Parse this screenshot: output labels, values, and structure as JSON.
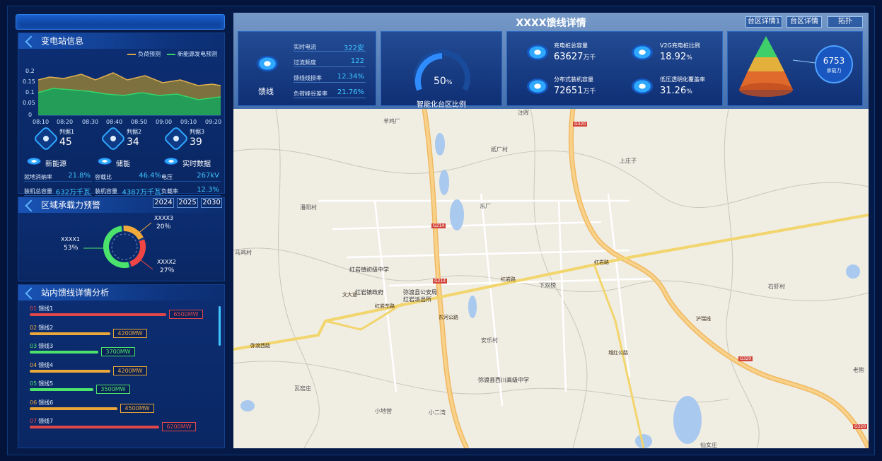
{
  "left": {
    "substation": {
      "title": "变电站信息",
      "legend": [
        {
          "label": "负荷预测",
          "color": "#d9a84a"
        },
        {
          "label": "新能源发电预测",
          "color": "#36d46a"
        }
      ],
      "y_ticks": [
        "0.2",
        "0.15",
        "0.1",
        "0.05",
        "0"
      ],
      "x_ticks": [
        "08:10",
        "08:20",
        "08:30",
        "08:40",
        "08:50",
        "09:00",
        "09:10",
        "09:20"
      ],
      "judges": [
        {
          "label": "判据1",
          "value": "45"
        },
        {
          "label": "判据2",
          "value": "34"
        },
        {
          "label": "判据3",
          "value": "39"
        }
      ],
      "sections": [
        {
          "title": "新能源",
          "rows": [
            {
              "k": "就地消纳率",
              "v": "21.8%"
            },
            {
              "k": "装机总容量",
              "v": "632万千瓦"
            }
          ]
        },
        {
          "title": "储能",
          "rows": [
            {
              "k": "容载比",
              "v": "46.4%"
            },
            {
              "k": "装机容量",
              "v": "4387万千瓦"
            }
          ]
        },
        {
          "title": "实时数据",
          "rows": [
            {
              "k": "电压",
              "v": "267kV"
            },
            {
              "k": "负载率",
              "v": "12.3%"
            }
          ]
        }
      ]
    },
    "warning": {
      "title": "区域承载力预警",
      "years": [
        "2024",
        "2025",
        "2030"
      ],
      "segments": [
        {
          "name": "XXXX1",
          "pct": "53％",
          "value": 53,
          "color": "#4be36c"
        },
        {
          "name": "XXXX2",
          "pct": "27％",
          "value": 27,
          "color": "#f04545"
        },
        {
          "name": "XXXX3",
          "pct": "20％",
          "value": 20,
          "color": "#f2a93a"
        }
      ]
    },
    "feeders": {
      "title": "站内馈线详情分析",
      "items": [
        {
          "no": "01",
          "name": "馈线1",
          "value": "6500MW",
          "num": 6500,
          "color": "#e0474b"
        },
        {
          "no": "02",
          "name": "馈线2",
          "value": "4200MW",
          "num": 4200,
          "color": "#eaa83a"
        },
        {
          "no": "03",
          "name": "馈线3",
          "value": "3700MW",
          "num": 3700,
          "color": "#4be36c"
        },
        {
          "no": "04",
          "name": "馈线4",
          "value": "4200MW",
          "num": 4200,
          "color": "#eaa83a"
        },
        {
          "no": "05",
          "name": "馈线5",
          "value": "3500MW",
          "num": 3500,
          "color": "#4be36c"
        },
        {
          "no": "06",
          "name": "馈线6",
          "value": "4500MW",
          "num": 4500,
          "color": "#eaa83a"
        },
        {
          "no": "07",
          "name": "馈线7",
          "value": "6200MW",
          "num": 6200,
          "color": "#e0474b"
        }
      ]
    }
  },
  "header": {
    "title": "XXXX馈线详情",
    "buttons": [
      "台区详情1",
      "台区详情",
      "拓扑"
    ],
    "feeder_label": "馈线",
    "feeder_stats": [
      {
        "k": "实时电流",
        "v": "322安"
      },
      {
        "k": "过流频度",
        "v": "122"
      },
      {
        "k": "馈线线损率",
        "v": "12.34%"
      },
      {
        "k": "负荷峰谷差率",
        "v": "21.76%"
      }
    ],
    "gauge": {
      "value": "50",
      "unit": "%",
      "label": "智能化台区比例"
    },
    "metrics": [
      {
        "label": "充电桩总容量",
        "value": "63627",
        "unit": "万千"
      },
      {
        "label": "V2G充电桩比例",
        "value": "18.92",
        "unit": "%"
      },
      {
        "label": "分布式装机容量",
        "value": "72651",
        "unit": "万千"
      },
      {
        "label": "低压透明化覆盖率",
        "value": "31.26",
        "unit": "%"
      }
    ],
    "capacity": {
      "value": "6753",
      "label": "承载力"
    }
  },
  "map": {
    "places": [
      "羊鸡厂",
      "纸厂村",
      "上庄子",
      "东厂",
      "潘阳村",
      "红岩镇初级中学",
      "红岩镇政府",
      "弥渡县公安局",
      "红岩派出所",
      "下双榜",
      "石虾村",
      "安乐村",
      "弥渡县西川高级中学",
      "瓦窑庄",
      "小地营",
      "小二湾",
      "仙女庄",
      "老熊",
      "马鸡村",
      "注晖"
    ],
    "roads": [
      "红岩路",
      "红岩东路",
      "弥渡西路",
      "东河公路",
      "沪瑞线",
      "红岩路",
      "城红公路",
      "文大道"
    ],
    "shields": [
      "G214",
      "G214",
      "G320",
      "G320",
      "G320"
    ]
  }
}
